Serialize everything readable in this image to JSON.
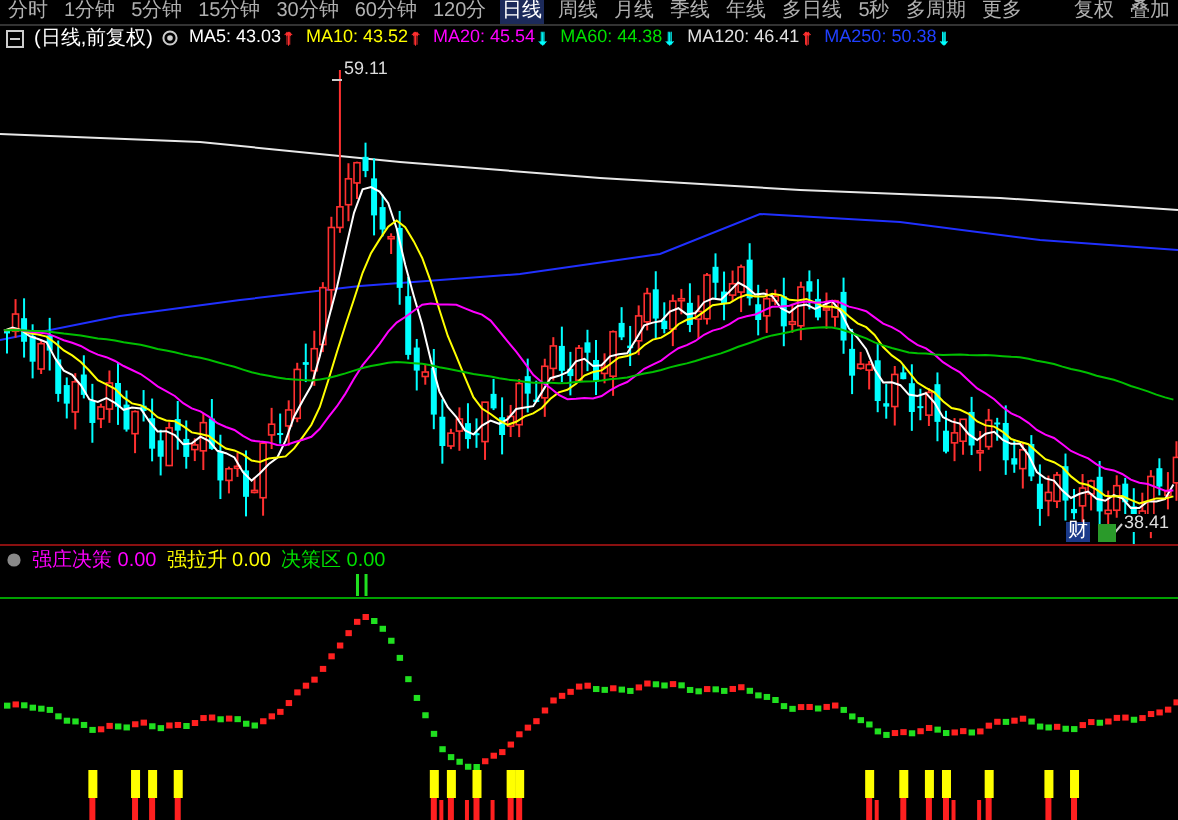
{
  "period_tabs": [
    {
      "label": "分时",
      "selected": false
    },
    {
      "label": "1分钟",
      "selected": false
    },
    {
      "label": "5分钟",
      "selected": false
    },
    {
      "label": "15分钟",
      "selected": false
    },
    {
      "label": "30分钟",
      "selected": false
    },
    {
      "label": "60分钟",
      "selected": false
    },
    {
      "label": "120分",
      "selected": false
    },
    {
      "label": "日线",
      "selected": true
    },
    {
      "label": "周线",
      "selected": false
    },
    {
      "label": "月线",
      "selected": false
    },
    {
      "label": "季线",
      "selected": false
    },
    {
      "label": "年线",
      "selected": false
    },
    {
      "label": "多日线",
      "selected": false
    },
    {
      "label": "5秒",
      "selected": false
    },
    {
      "label": "多周期",
      "selected": false
    },
    {
      "label": "更多",
      "selected": false
    }
  ],
  "right_buttons": [
    "复权",
    "叠加"
  ],
  "ma_legend": {
    "title": "(日线,前复权)",
    "items": [
      {
        "text": "MA5: 43.03",
        "color": "#ffffff",
        "arrow": {
          "text": "↑",
          "color": "#ff3030"
        }
      },
      {
        "text": "MA10: 43.52",
        "color": "#ffff00",
        "arrow": {
          "text": "↑",
          "color": "#ff3030"
        }
      },
      {
        "text": "MA20: 45.54",
        "color": "#ff00ff",
        "arrow": {
          "text": "↓",
          "color": "#00ffff"
        }
      },
      {
        "text": "MA60: 44.38",
        "color": "#00e000",
        "arrow": {
          "text": "↓",
          "color": "#00ffff"
        }
      },
      {
        "text": "MA120: 46.41",
        "color": "#e0e0e0",
        "arrow": {
          "text": "↑",
          "color": "#ff3030"
        }
      },
      {
        "text": "MA250: 50.38",
        "color": "#2040ff",
        "arrow": {
          "text": "↓",
          "color": "#00ffff"
        }
      }
    ]
  },
  "price_chart": {
    "high_label": "59.11",
    "low_label": "38.41",
    "badge": "财"
  },
  "indicator": {
    "items": [
      {
        "name": "强庄决策",
        "value": "0.00",
        "color": "#ff00ff"
      },
      {
        "name": "强拉升",
        "value": "0.00",
        "color": "#ffff00"
      },
      {
        "name": "决策区",
        "value": "0.00",
        "color": "#00e000"
      }
    ]
  }
}
